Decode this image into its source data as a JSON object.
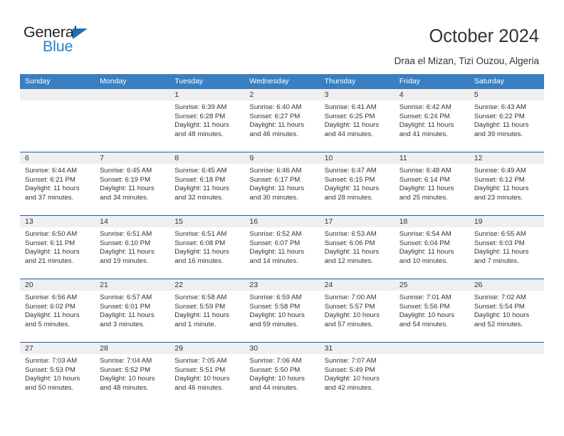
{
  "logo": {
    "word_top": "General",
    "word_bottom": "Blue",
    "triangle": "blue-triangle-icon",
    "accent_dark": "#231f20",
    "accent_blue": "#2a7fc9"
  },
  "header": {
    "title": "October 2024",
    "subtitle": "Draa el Mizan, Tizi Ouzou, Algeria"
  },
  "theme": {
    "header_blue": "#3a7fc1",
    "week_divider_blue": "#1f5fa0",
    "daynum_band": "#efefef",
    "text": "#333333"
  },
  "calendar": {
    "weekdays": [
      "Sunday",
      "Monday",
      "Tuesday",
      "Wednesday",
      "Thursday",
      "Friday",
      "Saturday"
    ],
    "weeks": [
      [
        {
          "day": "",
          "lines": []
        },
        {
          "day": "",
          "lines": []
        },
        {
          "day": "1",
          "lines": [
            "Sunrise: 6:39 AM",
            "Sunset: 6:28 PM",
            "Daylight: 11 hours",
            "and 48 minutes."
          ]
        },
        {
          "day": "2",
          "lines": [
            "Sunrise: 6:40 AM",
            "Sunset: 6:27 PM",
            "Daylight: 11 hours",
            "and 46 minutes."
          ]
        },
        {
          "day": "3",
          "lines": [
            "Sunrise: 6:41 AM",
            "Sunset: 6:25 PM",
            "Daylight: 11 hours",
            "and 44 minutes."
          ]
        },
        {
          "day": "4",
          "lines": [
            "Sunrise: 6:42 AM",
            "Sunset: 6:24 PM",
            "Daylight: 11 hours",
            "and 41 minutes."
          ]
        },
        {
          "day": "5",
          "lines": [
            "Sunrise: 6:43 AM",
            "Sunset: 6:22 PM",
            "Daylight: 11 hours",
            "and 39 minutes."
          ]
        }
      ],
      [
        {
          "day": "6",
          "lines": [
            "Sunrise: 6:44 AM",
            "Sunset: 6:21 PM",
            "Daylight: 11 hours",
            "and 37 minutes."
          ]
        },
        {
          "day": "7",
          "lines": [
            "Sunrise: 6:45 AM",
            "Sunset: 6:19 PM",
            "Daylight: 11 hours",
            "and 34 minutes."
          ]
        },
        {
          "day": "8",
          "lines": [
            "Sunrise: 6:45 AM",
            "Sunset: 6:18 PM",
            "Daylight: 11 hours",
            "and 32 minutes."
          ]
        },
        {
          "day": "9",
          "lines": [
            "Sunrise: 6:46 AM",
            "Sunset: 6:17 PM",
            "Daylight: 11 hours",
            "and 30 minutes."
          ]
        },
        {
          "day": "10",
          "lines": [
            "Sunrise: 6:47 AM",
            "Sunset: 6:15 PM",
            "Daylight: 11 hours",
            "and 28 minutes."
          ]
        },
        {
          "day": "11",
          "lines": [
            "Sunrise: 6:48 AM",
            "Sunset: 6:14 PM",
            "Daylight: 11 hours",
            "and 25 minutes."
          ]
        },
        {
          "day": "12",
          "lines": [
            "Sunrise: 6:49 AM",
            "Sunset: 6:12 PM",
            "Daylight: 11 hours",
            "and 23 minutes."
          ]
        }
      ],
      [
        {
          "day": "13",
          "lines": [
            "Sunrise: 6:50 AM",
            "Sunset: 6:11 PM",
            "Daylight: 11 hours",
            "and 21 minutes."
          ]
        },
        {
          "day": "14",
          "lines": [
            "Sunrise: 6:51 AM",
            "Sunset: 6:10 PM",
            "Daylight: 11 hours",
            "and 19 minutes."
          ]
        },
        {
          "day": "15",
          "lines": [
            "Sunrise: 6:51 AM",
            "Sunset: 6:08 PM",
            "Daylight: 11 hours",
            "and 16 minutes."
          ]
        },
        {
          "day": "16",
          "lines": [
            "Sunrise: 6:52 AM",
            "Sunset: 6:07 PM",
            "Daylight: 11 hours",
            "and 14 minutes."
          ]
        },
        {
          "day": "17",
          "lines": [
            "Sunrise: 6:53 AM",
            "Sunset: 6:06 PM",
            "Daylight: 11 hours",
            "and 12 minutes."
          ]
        },
        {
          "day": "18",
          "lines": [
            "Sunrise: 6:54 AM",
            "Sunset: 6:04 PM",
            "Daylight: 11 hours",
            "and 10 minutes."
          ]
        },
        {
          "day": "19",
          "lines": [
            "Sunrise: 6:55 AM",
            "Sunset: 6:03 PM",
            "Daylight: 11 hours",
            "and 7 minutes."
          ]
        }
      ],
      [
        {
          "day": "20",
          "lines": [
            "Sunrise: 6:56 AM",
            "Sunset: 6:02 PM",
            "Daylight: 11 hours",
            "and 5 minutes."
          ]
        },
        {
          "day": "21",
          "lines": [
            "Sunrise: 6:57 AM",
            "Sunset: 6:01 PM",
            "Daylight: 11 hours",
            "and 3 minutes."
          ]
        },
        {
          "day": "22",
          "lines": [
            "Sunrise: 6:58 AM",
            "Sunset: 5:59 PM",
            "Daylight: 11 hours",
            "and 1 minute."
          ]
        },
        {
          "day": "23",
          "lines": [
            "Sunrise: 6:59 AM",
            "Sunset: 5:58 PM",
            "Daylight: 10 hours",
            "and 59 minutes."
          ]
        },
        {
          "day": "24",
          "lines": [
            "Sunrise: 7:00 AM",
            "Sunset: 5:57 PM",
            "Daylight: 10 hours",
            "and 57 minutes."
          ]
        },
        {
          "day": "25",
          "lines": [
            "Sunrise: 7:01 AM",
            "Sunset: 5:56 PM",
            "Daylight: 10 hours",
            "and 54 minutes."
          ]
        },
        {
          "day": "26",
          "lines": [
            "Sunrise: 7:02 AM",
            "Sunset: 5:54 PM",
            "Daylight: 10 hours",
            "and 52 minutes."
          ]
        }
      ],
      [
        {
          "day": "27",
          "lines": [
            "Sunrise: 7:03 AM",
            "Sunset: 5:53 PM",
            "Daylight: 10 hours",
            "and 50 minutes."
          ]
        },
        {
          "day": "28",
          "lines": [
            "Sunrise: 7:04 AM",
            "Sunset: 5:52 PM",
            "Daylight: 10 hours",
            "and 48 minutes."
          ]
        },
        {
          "day": "29",
          "lines": [
            "Sunrise: 7:05 AM",
            "Sunset: 5:51 PM",
            "Daylight: 10 hours",
            "and 46 minutes."
          ]
        },
        {
          "day": "30",
          "lines": [
            "Sunrise: 7:06 AM",
            "Sunset: 5:50 PM",
            "Daylight: 10 hours",
            "and 44 minutes."
          ]
        },
        {
          "day": "31",
          "lines": [
            "Sunrise: 7:07 AM",
            "Sunset: 5:49 PM",
            "Daylight: 10 hours",
            "and 42 minutes."
          ]
        },
        {
          "day": "",
          "lines": []
        },
        {
          "day": "",
          "lines": []
        }
      ]
    ]
  }
}
